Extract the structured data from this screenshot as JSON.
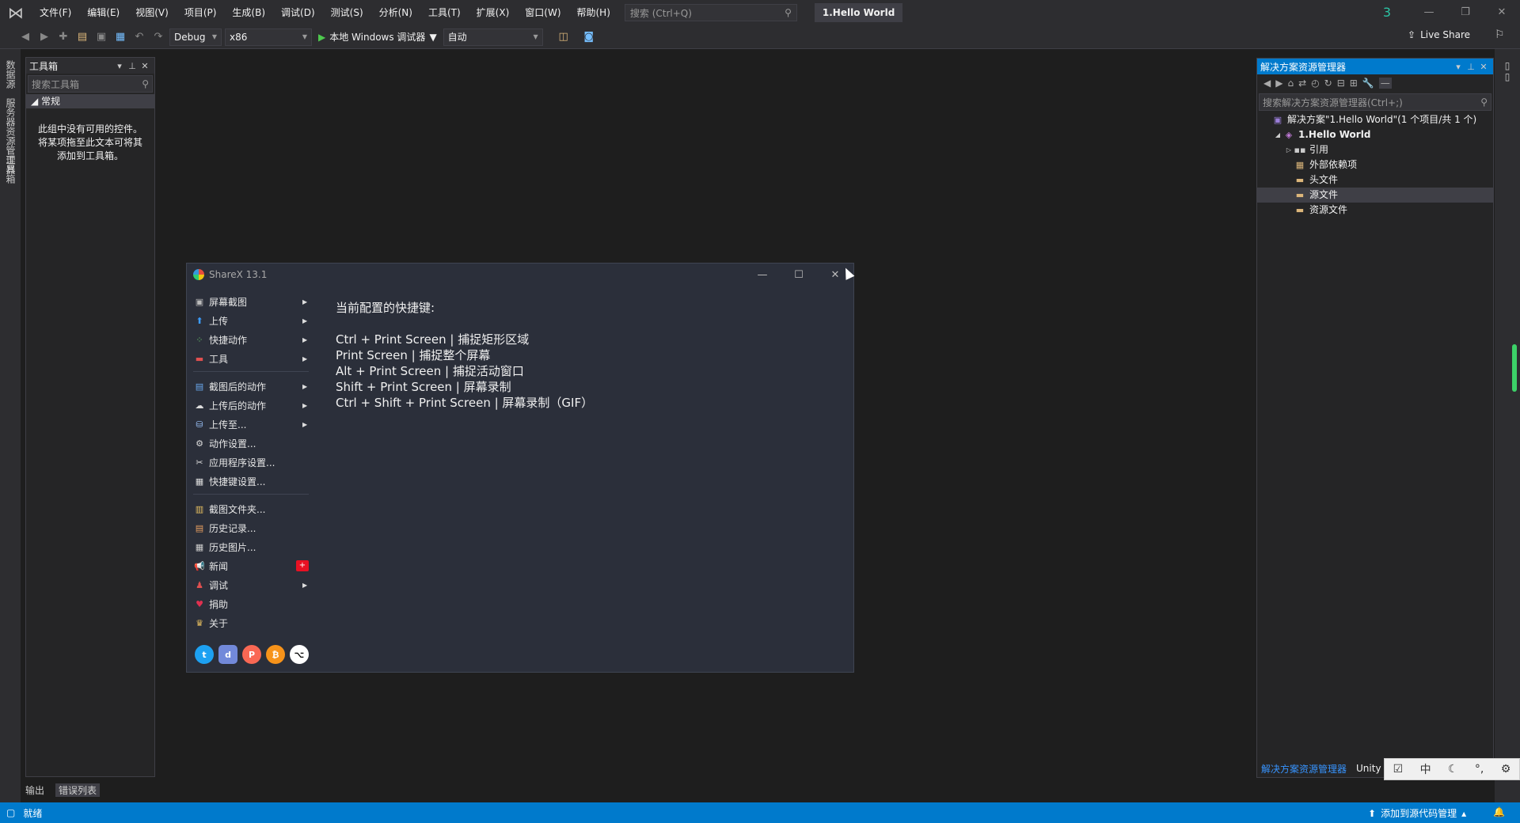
{
  "app": {
    "menu": [
      "文件(F)",
      "编辑(E)",
      "视图(V)",
      "项目(P)",
      "生成(B)",
      "调试(D)",
      "测试(S)",
      "分析(N)",
      "工具(T)",
      "扩展(X)",
      "窗口(W)",
      "帮助(H)"
    ],
    "search_placeholder": "搜索 (Ctrl+Q)",
    "project_title": "1.Hello World",
    "notification_count": "3",
    "live_share": "Live Share"
  },
  "toolbar": {
    "config": "Debug",
    "platform": "x86",
    "run_label": "本地 Windows 调试器",
    "auto_label": "自动"
  },
  "left_strip": {
    "tabs": [
      "数据源",
      "服务器资源管理器",
      "工具箱"
    ]
  },
  "toolbox": {
    "title": "工具箱",
    "search_placeholder": "搜索工具箱",
    "group": "常规",
    "empty_line1": "此组中没有可用的控件。",
    "empty_line2": "将某项拖至此文本可将其",
    "empty_line3": "添加到工具箱。"
  },
  "bottom_tabs": [
    "输出",
    "错误列表"
  ],
  "status": {
    "ready": "就绪",
    "source_control": "添加到源代码管理"
  },
  "solution_explorer": {
    "title": "解决方案资源管理器",
    "search_placeholder": "搜索解决方案资源管理器(Ctrl+;)",
    "tree": [
      {
        "label": "解决方案\"1.Hello World\"(1 个项目/共 1 个)",
        "icon": "solution-icon",
        "indent": 0
      },
      {
        "label": "1.Hello World",
        "icon": "cpp-project-icon",
        "indent": 1,
        "bold": true
      },
      {
        "label": "引用",
        "icon": "references-icon",
        "indent": 2
      },
      {
        "label": "外部依赖项",
        "icon": "external-deps-icon",
        "indent": 2
      },
      {
        "label": "头文件",
        "icon": "folder-icon",
        "indent": 2
      },
      {
        "label": "源文件",
        "icon": "folder-icon",
        "indent": 2,
        "selected": true
      },
      {
        "label": "资源文件",
        "icon": "folder-icon",
        "indent": 2
      }
    ],
    "bottom_tabs": [
      "解决方案资源管理器",
      "Unity"
    ]
  },
  "ime": [
    "中"
  ],
  "sharex": {
    "title": "ShareX 13.1",
    "menu": [
      {
        "label": "屏幕截图",
        "icon": "screenshot-icon",
        "arrow": true
      },
      {
        "label": "上传",
        "icon": "upload-icon",
        "arrow": true
      },
      {
        "label": "快捷动作",
        "icon": "workflow-icon",
        "arrow": true
      },
      {
        "label": "工具",
        "icon": "tools-icon",
        "arrow": true
      },
      {
        "sep": true
      },
      {
        "label": "截图后的动作",
        "icon": "after-capture-icon",
        "arrow": true
      },
      {
        "label": "上传后的动作",
        "icon": "after-upload-icon",
        "arrow": true
      },
      {
        "label": "上传至...",
        "icon": "destinations-icon",
        "arrow": true
      },
      {
        "label": "动作设置...",
        "icon": "task-settings-icon"
      },
      {
        "label": "应用程序设置...",
        "icon": "app-settings-icon"
      },
      {
        "label": "快捷键设置...",
        "icon": "hotkey-settings-icon"
      },
      {
        "sep": true
      },
      {
        "label": "截图文件夹...",
        "icon": "screenshots-folder-icon"
      },
      {
        "label": "历史记录...",
        "icon": "history-icon"
      },
      {
        "label": "历史图片...",
        "icon": "image-history-icon"
      },
      {
        "label": "新闻",
        "icon": "news-icon",
        "badge": "+"
      },
      {
        "label": "调试",
        "icon": "debug-icon",
        "arrow": true
      },
      {
        "label": "捐助",
        "icon": "donate-icon"
      },
      {
        "label": "关于",
        "icon": "about-icon"
      }
    ],
    "hotkeys_title": "当前配置的快捷键:",
    "hotkeys": [
      "Ctrl + Print Screen  |  捕捉矩形区域",
      "Print Screen  |  捕捉整个屏幕",
      "Alt + Print Screen  |  捕捉活动窗口",
      "Shift + Print Screen  |  屏幕录制",
      "Ctrl + Shift + Print Screen  |  屏幕录制（GIF）"
    ]
  }
}
